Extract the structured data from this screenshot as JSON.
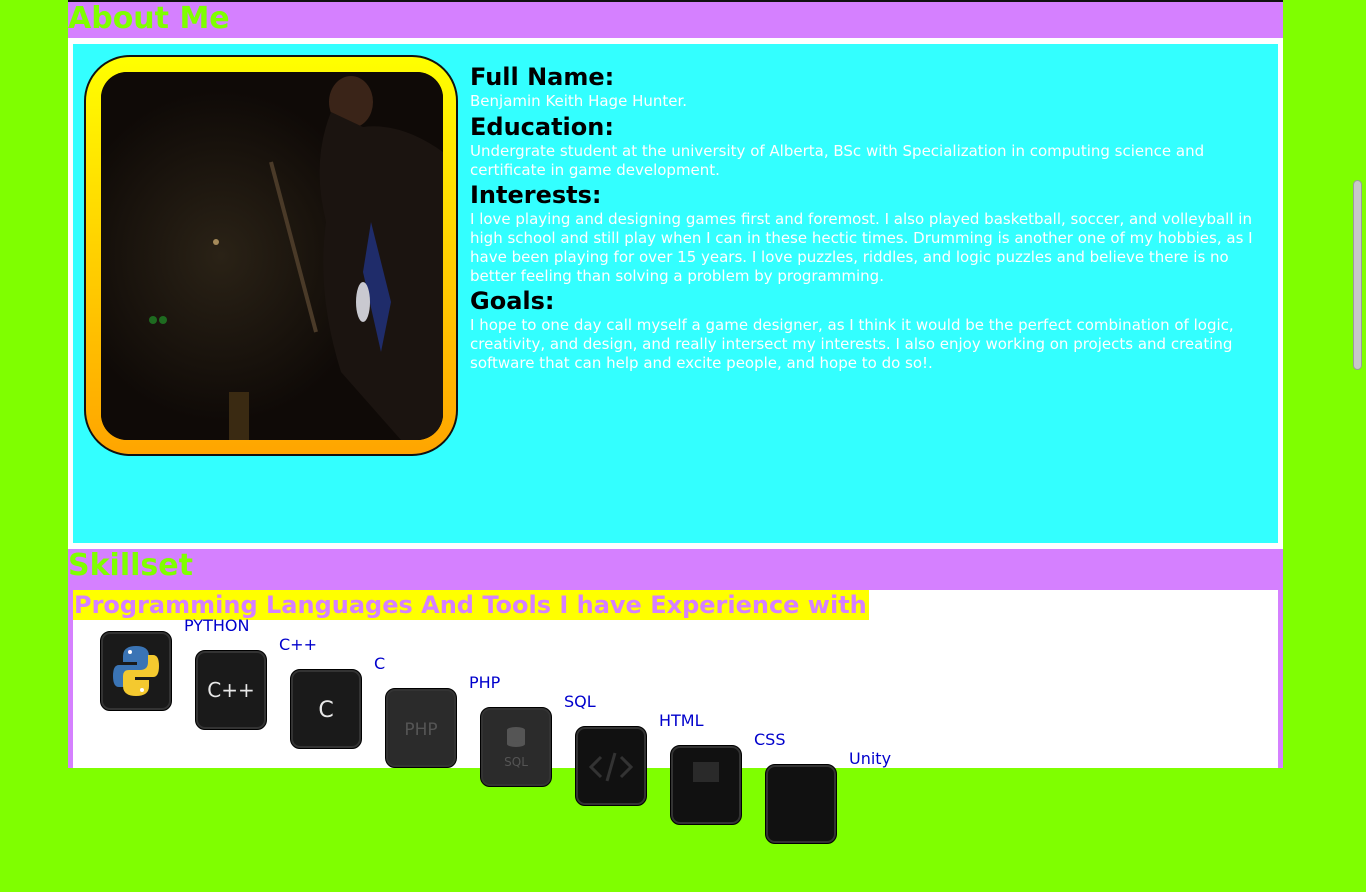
{
  "about": {
    "title": "About Me",
    "full_name_heading": "Full Name:",
    "full_name": "Benjamin Keith Hage Hunter.",
    "education_heading": "Education:",
    "education": "Undergrate student at the university of Alberta, BSc with Specialization in computing science and certificate in game development.",
    "interests_heading": "Interests:",
    "interests": "I love playing and designing games first and foremost. I also played basketball, soccer, and volleyball in high school and still play when I can in these hectic times. Drumming is another one of my hobbies, as I have been playing for over 15 years. I love puzzles, riddles, and logic puzzles and believe there is no better feeling than solving a problem by programming.",
    "goals_heading": "Goals:",
    "goals": "I hope to one day call myself a game designer, as I think it would be the perfect combination of logic, creativity, and design, and really intersect my interests. I also enjoy working on projects and creating software that can help and excite people, and hope to do so!."
  },
  "skillset": {
    "title": "Skillset",
    "heading": "Programming Languages And Tools I have Experience with",
    "items": [
      {
        "label": "PYTHON",
        "icon": "python-icon"
      },
      {
        "label": "C++",
        "icon": "cpp-icon"
      },
      {
        "label": "C",
        "icon": "c-icon"
      },
      {
        "label": "PHP",
        "icon": "php-icon"
      },
      {
        "label": "SQL",
        "icon": "sql-icon"
      },
      {
        "label": "HTML",
        "icon": "html-icon"
      },
      {
        "label": "CSS",
        "icon": "css-icon"
      },
      {
        "label": "Unity",
        "icon": "unity-icon"
      }
    ]
  },
  "colors": {
    "background": "#7fff00",
    "page": "#d580ff",
    "about_panel": "#33ffff",
    "heading_highlight": "#ffff00",
    "link": "#0000cc"
  }
}
